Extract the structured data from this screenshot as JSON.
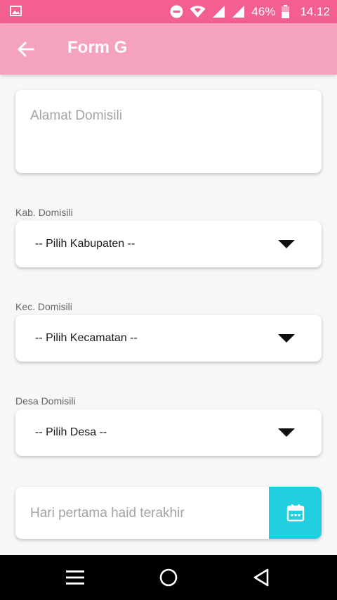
{
  "status_bar": {
    "battery": "46%",
    "time": "14.12",
    "icons": [
      "image-icon",
      "do-not-disturb-icon",
      "wifi-icon",
      "signal-icon",
      "signal-icon",
      "battery-icon"
    ]
  },
  "app_bar": {
    "title": "Form G",
    "back_icon": "arrow-back-icon"
  },
  "form": {
    "alamat": {
      "placeholder": "Alamat Domisili"
    },
    "kabupaten": {
      "label": "Kab. Domisili",
      "value": "-- Pilih Kabupaten --"
    },
    "kecamatan": {
      "label": "Kec. Domisili",
      "value": "-- Pilih Kecamatan --"
    },
    "desa": {
      "label": "Desa Domisili",
      "value": "-- Pilih Desa --"
    },
    "hpht": {
      "placeholder": "Hari pertama haid terakhir",
      "button_icon": "calendar-icon"
    }
  },
  "colors": {
    "status_bar": "#f35e93",
    "app_bar": "#f5a2c1",
    "calendar_button": "#22cfe0",
    "nav_bar": "#000000"
  },
  "nav_bar": {
    "icons": [
      "menu-icon",
      "home-circle-icon",
      "back-triangle-icon"
    ]
  }
}
